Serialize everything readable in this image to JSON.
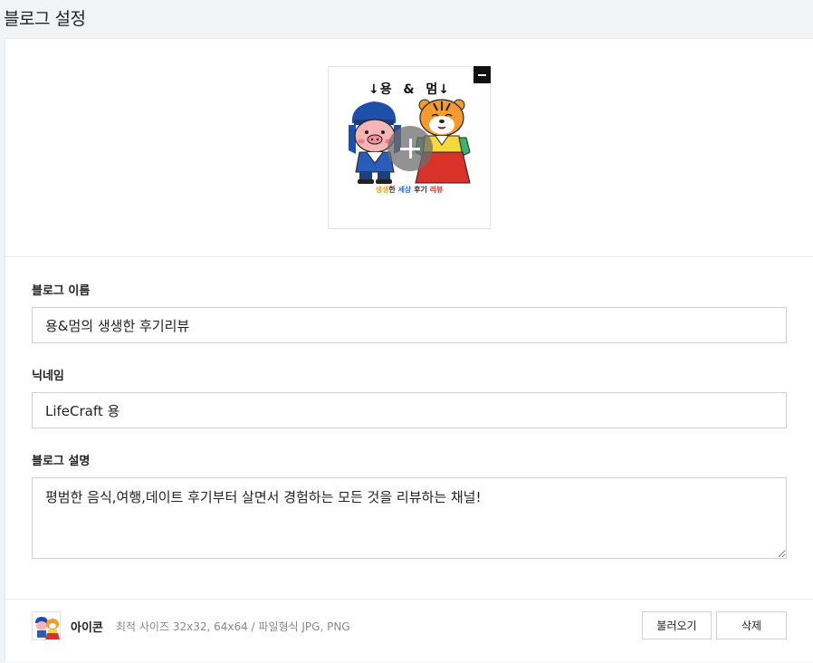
{
  "page": {
    "title": "블로그 설정"
  },
  "profile_image": {
    "logo_top_text": "↓용  &  멈↓",
    "caption_part1": "생생",
    "caption_part2": "한 ",
    "caption_part3": "세상",
    "caption_part4": " 후기 ",
    "caption_part5": "리뷰"
  },
  "form": {
    "blog_name_label": "블로그 이름",
    "blog_name_value": "용&멈의 생생한 후기리뷰",
    "nickname_label": "닉네임",
    "nickname_value": "LifeCraft 용",
    "description_label": "블로그 설명",
    "description_value": "평범한 음식,여행,데이트 후기부터 살면서 경험하는 모든 것을 리뷰하는 채널!"
  },
  "footer": {
    "icon_label": "아이콘",
    "icon_hint": "최적 사이즈 32x32, 64x64 / 파일형식 JPG, PNG",
    "load_button": "불러오기",
    "delete_button": "삭제"
  },
  "colors": {
    "page_bg": "#f1f3f5",
    "panel_bg": "#ffffff",
    "border": "#cfcfcf",
    "pig_hat": "#1f4fa8",
    "pig_face": "#f6b5b5",
    "tiger_orange": "#f59a2f",
    "hanbok_yellow": "#f5d83b",
    "hanbok_red": "#d8322a"
  },
  "icons": {
    "remove_image": "minus-icon",
    "add_image": "plus-icon",
    "resize_handle": "resize-grip-icon"
  }
}
